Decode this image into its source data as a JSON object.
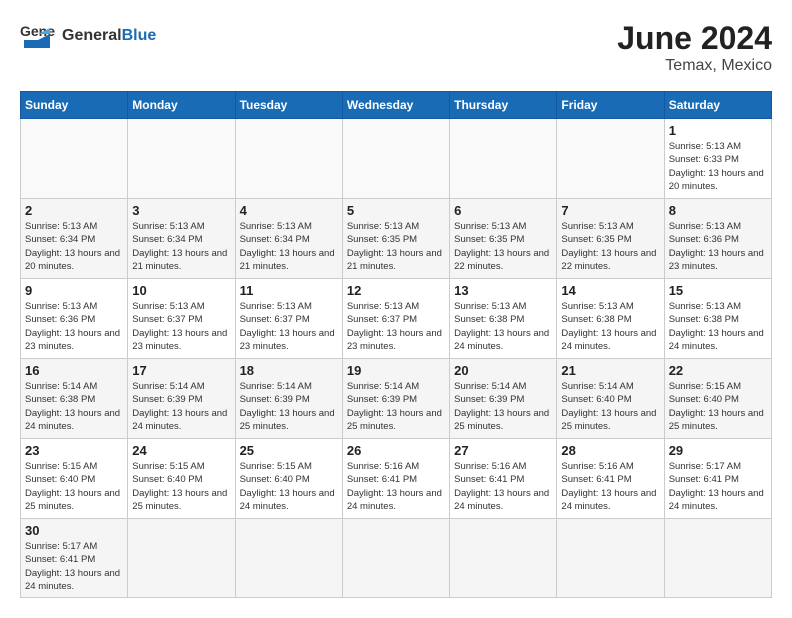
{
  "header": {
    "logo_general": "General",
    "logo_blue": "Blue",
    "month": "June 2024",
    "location": "Temax, Mexico"
  },
  "days_of_week": [
    "Sunday",
    "Monday",
    "Tuesday",
    "Wednesday",
    "Thursday",
    "Friday",
    "Saturday"
  ],
  "weeks": [
    [
      {
        "day": "",
        "info": ""
      },
      {
        "day": "",
        "info": ""
      },
      {
        "day": "",
        "info": ""
      },
      {
        "day": "",
        "info": ""
      },
      {
        "day": "",
        "info": ""
      },
      {
        "day": "",
        "info": ""
      },
      {
        "day": "1",
        "info": "Sunrise: 5:13 AM\nSunset: 6:33 PM\nDaylight: 13 hours and 20 minutes."
      }
    ],
    [
      {
        "day": "2",
        "info": "Sunrise: 5:13 AM\nSunset: 6:34 PM\nDaylight: 13 hours and 20 minutes."
      },
      {
        "day": "3",
        "info": "Sunrise: 5:13 AM\nSunset: 6:34 PM\nDaylight: 13 hours and 21 minutes."
      },
      {
        "day": "4",
        "info": "Sunrise: 5:13 AM\nSunset: 6:34 PM\nDaylight: 13 hours and 21 minutes."
      },
      {
        "day": "5",
        "info": "Sunrise: 5:13 AM\nSunset: 6:35 PM\nDaylight: 13 hours and 21 minutes."
      },
      {
        "day": "6",
        "info": "Sunrise: 5:13 AM\nSunset: 6:35 PM\nDaylight: 13 hours and 22 minutes."
      },
      {
        "day": "7",
        "info": "Sunrise: 5:13 AM\nSunset: 6:35 PM\nDaylight: 13 hours and 22 minutes."
      },
      {
        "day": "8",
        "info": "Sunrise: 5:13 AM\nSunset: 6:36 PM\nDaylight: 13 hours and 23 minutes."
      }
    ],
    [
      {
        "day": "9",
        "info": "Sunrise: 5:13 AM\nSunset: 6:36 PM\nDaylight: 13 hours and 23 minutes."
      },
      {
        "day": "10",
        "info": "Sunrise: 5:13 AM\nSunset: 6:37 PM\nDaylight: 13 hours and 23 minutes."
      },
      {
        "day": "11",
        "info": "Sunrise: 5:13 AM\nSunset: 6:37 PM\nDaylight: 13 hours and 23 minutes."
      },
      {
        "day": "12",
        "info": "Sunrise: 5:13 AM\nSunset: 6:37 PM\nDaylight: 13 hours and 23 minutes."
      },
      {
        "day": "13",
        "info": "Sunrise: 5:13 AM\nSunset: 6:38 PM\nDaylight: 13 hours and 24 minutes."
      },
      {
        "day": "14",
        "info": "Sunrise: 5:13 AM\nSunset: 6:38 PM\nDaylight: 13 hours and 24 minutes."
      },
      {
        "day": "15",
        "info": "Sunrise: 5:13 AM\nSunset: 6:38 PM\nDaylight: 13 hours and 24 minutes."
      }
    ],
    [
      {
        "day": "16",
        "info": "Sunrise: 5:14 AM\nSunset: 6:38 PM\nDaylight: 13 hours and 24 minutes."
      },
      {
        "day": "17",
        "info": "Sunrise: 5:14 AM\nSunset: 6:39 PM\nDaylight: 13 hours and 24 minutes."
      },
      {
        "day": "18",
        "info": "Sunrise: 5:14 AM\nSunset: 6:39 PM\nDaylight: 13 hours and 25 minutes."
      },
      {
        "day": "19",
        "info": "Sunrise: 5:14 AM\nSunset: 6:39 PM\nDaylight: 13 hours and 25 minutes."
      },
      {
        "day": "20",
        "info": "Sunrise: 5:14 AM\nSunset: 6:39 PM\nDaylight: 13 hours and 25 minutes."
      },
      {
        "day": "21",
        "info": "Sunrise: 5:14 AM\nSunset: 6:40 PM\nDaylight: 13 hours and 25 minutes."
      },
      {
        "day": "22",
        "info": "Sunrise: 5:15 AM\nSunset: 6:40 PM\nDaylight: 13 hours and 25 minutes."
      }
    ],
    [
      {
        "day": "23",
        "info": "Sunrise: 5:15 AM\nSunset: 6:40 PM\nDaylight: 13 hours and 25 minutes."
      },
      {
        "day": "24",
        "info": "Sunrise: 5:15 AM\nSunset: 6:40 PM\nDaylight: 13 hours and 25 minutes."
      },
      {
        "day": "25",
        "info": "Sunrise: 5:15 AM\nSunset: 6:40 PM\nDaylight: 13 hours and 24 minutes."
      },
      {
        "day": "26",
        "info": "Sunrise: 5:16 AM\nSunset: 6:41 PM\nDaylight: 13 hours and 24 minutes."
      },
      {
        "day": "27",
        "info": "Sunrise: 5:16 AM\nSunset: 6:41 PM\nDaylight: 13 hours and 24 minutes."
      },
      {
        "day": "28",
        "info": "Sunrise: 5:16 AM\nSunset: 6:41 PM\nDaylight: 13 hours and 24 minutes."
      },
      {
        "day": "29",
        "info": "Sunrise: 5:17 AM\nSunset: 6:41 PM\nDaylight: 13 hours and 24 minutes."
      }
    ],
    [
      {
        "day": "30",
        "info": "Sunrise: 5:17 AM\nSunset: 6:41 PM\nDaylight: 13 hours and 24 minutes."
      },
      {
        "day": "",
        "info": ""
      },
      {
        "day": "",
        "info": ""
      },
      {
        "day": "",
        "info": ""
      },
      {
        "day": "",
        "info": ""
      },
      {
        "day": "",
        "info": ""
      },
      {
        "day": "",
        "info": ""
      }
    ]
  ]
}
